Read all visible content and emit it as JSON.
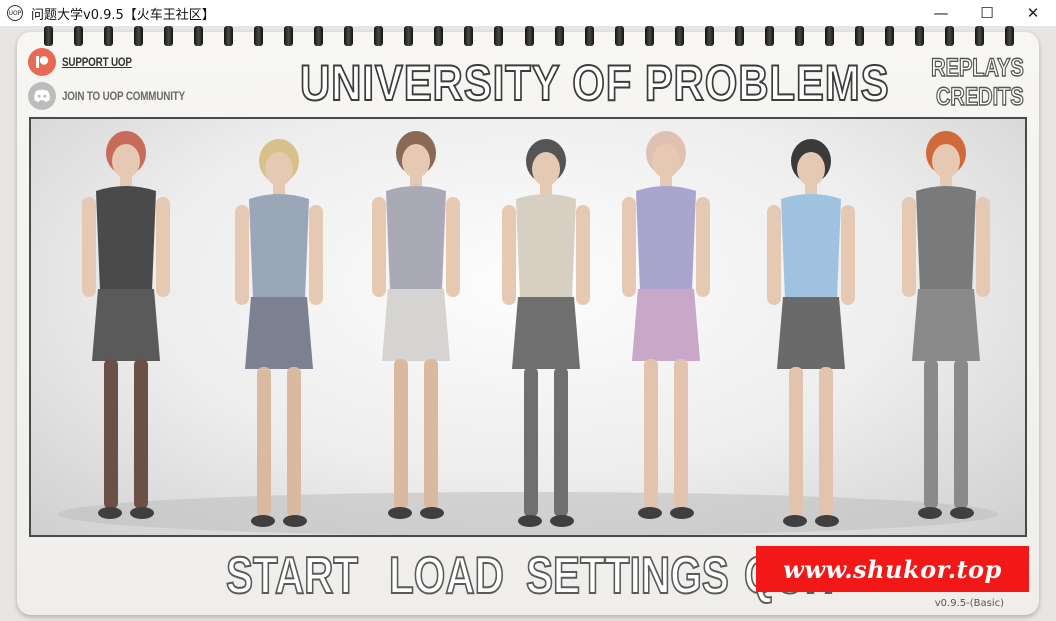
{
  "window": {
    "icon_text": "UOP",
    "title": "问题大学v0.9.5【火车王社区】",
    "minimize": "—",
    "maximize": "☐",
    "close": "✕"
  },
  "links": {
    "patreon_label": "SUPPORT UOP",
    "patreon_icon": "patreon-icon",
    "discord_label": "JOIN TO UOP COMMUNITY",
    "discord_icon": "discord-icon"
  },
  "header": {
    "title": "UNIVERSITY OF PROBLEMS",
    "replays": "REPLAYS",
    "credits": "CREDITS"
  },
  "main_menu": {
    "start": "START",
    "load": "LOAD",
    "settings": "SETTINGS",
    "quit": "QUIT"
  },
  "watermark": "www.shukor.top",
  "version": "v0.9.5-(Basic)",
  "colors": {
    "patreon": "#e86a53",
    "watermark_bg": "#f21818",
    "paper": "#f4f3ef"
  }
}
